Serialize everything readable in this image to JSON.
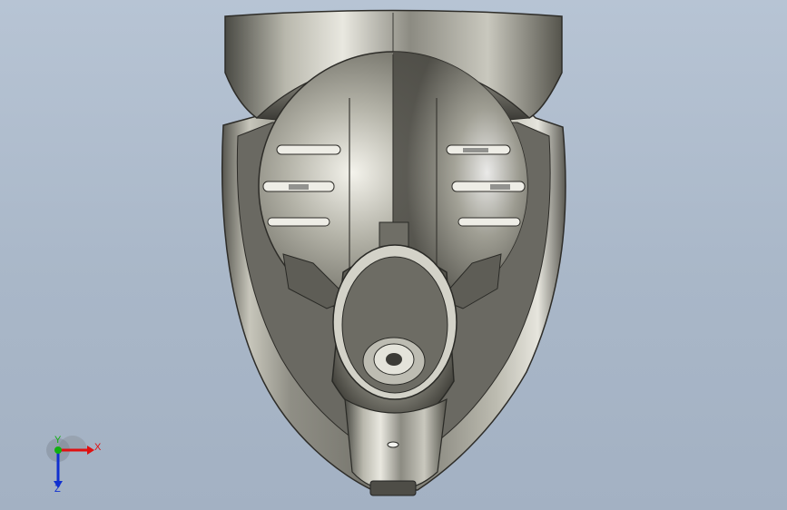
{
  "viewport": {
    "background_top": "#b7c4d4",
    "background_bottom": "#a3b1c3"
  },
  "model": {
    "description_icon": "cad-3d-part"
  },
  "triad": {
    "x_label": "X",
    "y_label": "Y",
    "z_label": "Z",
    "x_color": "#e01010",
    "y_color": "#10b010",
    "z_color": "#1030d0"
  }
}
